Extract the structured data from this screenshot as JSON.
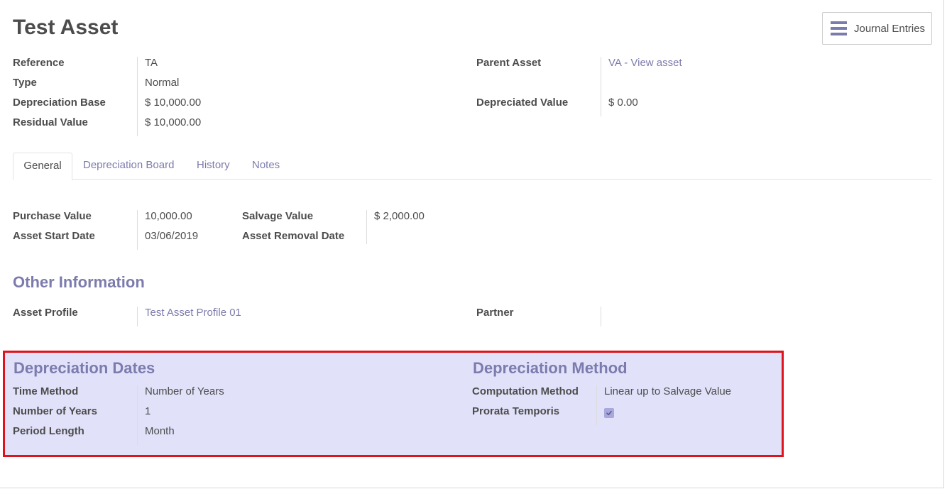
{
  "header": {
    "title": "Test Asset",
    "journal_button_label": "Journal Entries"
  },
  "summary": {
    "left": [
      {
        "label": "Reference",
        "value": "TA"
      },
      {
        "label": "Type",
        "value": "Normal"
      },
      {
        "label": "Depreciation Base",
        "value": "$ 10,000.00"
      },
      {
        "label": "Residual Value",
        "value": "$ 10,000.00"
      }
    ],
    "right": {
      "parent_asset_label": "Parent Asset",
      "parent_asset_value": "VA - View asset",
      "depreciated_value_label": "Depreciated Value",
      "depreciated_value": "$ 0.00"
    }
  },
  "tabs": [
    "General",
    "Depreciation Board",
    "History",
    "Notes"
  ],
  "general": {
    "purchase_value_label": "Purchase Value",
    "purchase_value": "10,000.00",
    "asset_start_date_label": "Asset Start Date",
    "asset_start_date": "03/06/2019",
    "salvage_value_label": "Salvage Value",
    "salvage_value": "$ 2,000.00",
    "asset_removal_date_label": "Asset Removal Date",
    "asset_removal_date": ""
  },
  "other_info": {
    "heading": "Other Information",
    "asset_profile_label": "Asset Profile",
    "asset_profile_value": "Test Asset Profile 01",
    "partner_label": "Partner",
    "partner_value": ""
  },
  "depreciation_dates": {
    "heading": "Depreciation Dates",
    "time_method_label": "Time Method",
    "time_method": "Number of Years",
    "number_of_years_label": "Number of Years",
    "number_of_years": "1",
    "period_length_label": "Period Length",
    "period_length": "Month"
  },
  "depreciation_method": {
    "heading": "Depreciation Method",
    "computation_method_label": "Computation Method",
    "computation_method": "Linear up to Salvage Value",
    "prorata_temporis_label": "Prorata Temporis",
    "prorata_temporis_checked": true
  },
  "colors": {
    "accent": "#7c7bad",
    "highlight_bg": "#e1e2fa",
    "highlight_border": "#e0121b"
  }
}
